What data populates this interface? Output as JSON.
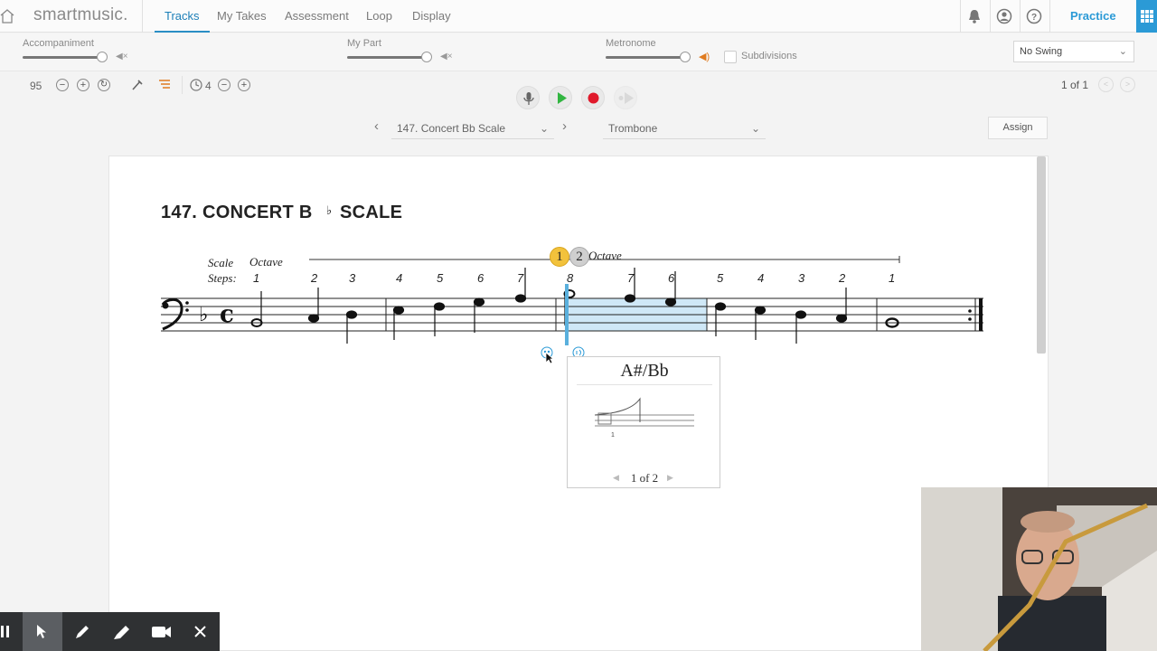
{
  "app": {
    "logo": "smartmusic."
  },
  "nav": {
    "tabs": [
      "Tracks",
      "My Takes",
      "Assessment",
      "Loop",
      "Display"
    ],
    "active": "Tracks",
    "practice": "Practice"
  },
  "mixer": {
    "accompaniment": {
      "label": "Accompaniment",
      "level": 1.0
    },
    "my_part": {
      "label": "My Part",
      "level": 1.0
    },
    "metronome": {
      "label": "Metronome",
      "level": 1.0
    },
    "subdivisions_label": "Subdivisions",
    "swing": "No Swing"
  },
  "toolbar": {
    "tempo": "95",
    "countoff": "4",
    "pager": "1 of 1"
  },
  "selector": {
    "title": "147. Concert Bb Scale",
    "instrument": "Trombone",
    "assign": "Assign"
  },
  "score": {
    "title_a": "147.  CONCERT B",
    "title_flat": "♭",
    "title_b": "SCALE",
    "scale_label": "Scale",
    "steps_label": "Steps:",
    "octave_label": "Octave",
    "octave_label2": "Octave",
    "badge1": "1",
    "badge2": "2",
    "steps": [
      "1",
      "2",
      "3",
      "4",
      "5",
      "6",
      "7",
      "8",
      "7",
      "6",
      "5",
      "4",
      "3",
      "2",
      "1"
    ]
  },
  "popup": {
    "note_name": "A#/Bb",
    "position": "1",
    "page": "1 of 2"
  },
  "colors": {
    "accent": "#2b9ad6",
    "highlight": "#cfe8f7",
    "record": "#e0192b",
    "play": "#31b540",
    "badge_yellow": "#f2c23c"
  }
}
